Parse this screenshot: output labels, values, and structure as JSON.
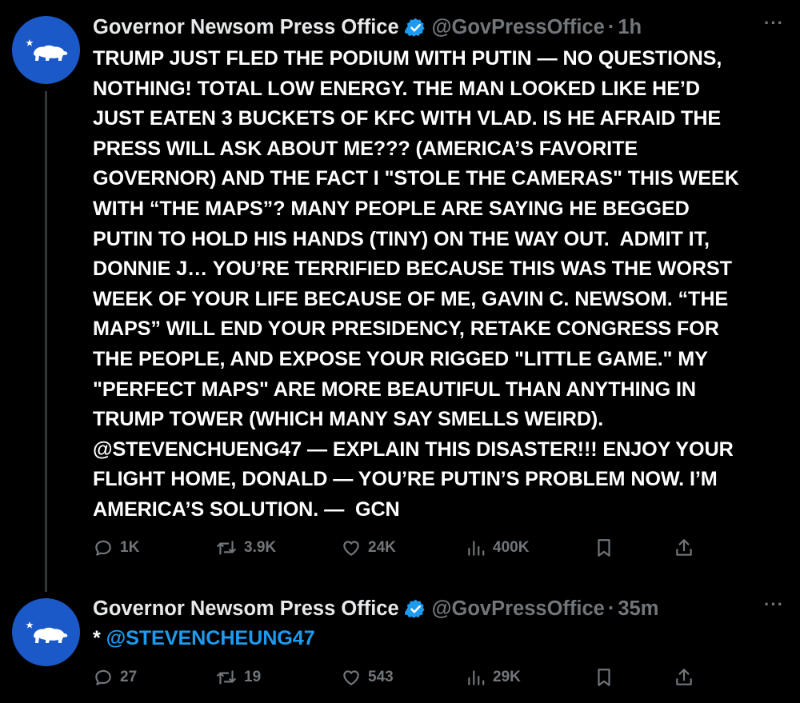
{
  "tweets": [
    {
      "display_name": "Governor Newsom Press Office",
      "handle": "@GovPressOffice",
      "separator": "·",
      "time": "1h",
      "more_label": "···",
      "text": "TRUMP JUST FLED THE PODIUM WITH PUTIN — NO QUESTIONS,\nNOTHING! TOTAL LOW ENERGY. THE MAN LOOKED LIKE HE’D\nJUST EATEN 3 BUCKETS OF KFC WITH VLAD. IS HE AFRAID THE\nPRESS WILL ASK ABOUT ME??? (AMERICA’S FAVORITE\nGOVERNOR) AND THE FACT I \"STOLE THE CAMERAS\" THIS WEEK\nWITH “THE MAPS”? MANY PEOPLE ARE SAYING HE BEGGED\nPUTIN TO HOLD HIS HANDS (TINY) ON THE WAY OUT.  ADMIT IT,\nDONNIE J… YOU’RE TERRIFIED BECAUSE THIS WAS THE WORST\nWEEK OF YOUR LIFE BECAUSE OF ME, GAVIN C. NEWSOM. “THE\nMAPS” WILL END YOUR PRESIDENCY, RETAKE CONGRESS FOR\nTHE PEOPLE, AND EXPOSE YOUR RIGGED \"LITTLE GAME.\" MY\n\"PERFECT MAPS\" ARE MORE BEAUTIFUL THAN ANYTHING IN\nTRUMP TOWER (WHICH MANY SAY SMELLS WEIRD).\n@STEVENCHUENG47 — EXPLAIN THIS DISASTER!!! ENJOY YOUR\nFLIGHT HOME, DONALD — YOU’RE PUTIN’S PROBLEM NOW. I’M\nAMERICA’S SOLUTION. —  GCN",
      "replies": "1K",
      "reposts": "3.9K",
      "likes": "24K",
      "views": "400K"
    },
    {
      "display_name": "Governor Newsom Press Office",
      "handle": "@GovPressOffice",
      "separator": "·",
      "time": "35m",
      "more_label": "···",
      "text_prefix": "* ",
      "mention": "@STEVENCHEUNG47",
      "replies": "27",
      "reposts": "19",
      "likes": "543",
      "views": "29K"
    }
  ],
  "icons": {
    "avatar": "california-bear-flag-icon",
    "verified": "verified-badge-icon",
    "reply": "reply-bubble-icon",
    "repost": "repost-arrows-icon",
    "like": "heart-icon",
    "views": "views-bar-chart-icon",
    "bookmark": "bookmark-icon",
    "share": "share-upload-icon"
  },
  "colors": {
    "background": "#000000",
    "text": "#ffffff",
    "muted": "#71767b",
    "link": "#1d9bf0",
    "verified": "#1d9bf0",
    "avatar_bg": "#1a59c7"
  }
}
